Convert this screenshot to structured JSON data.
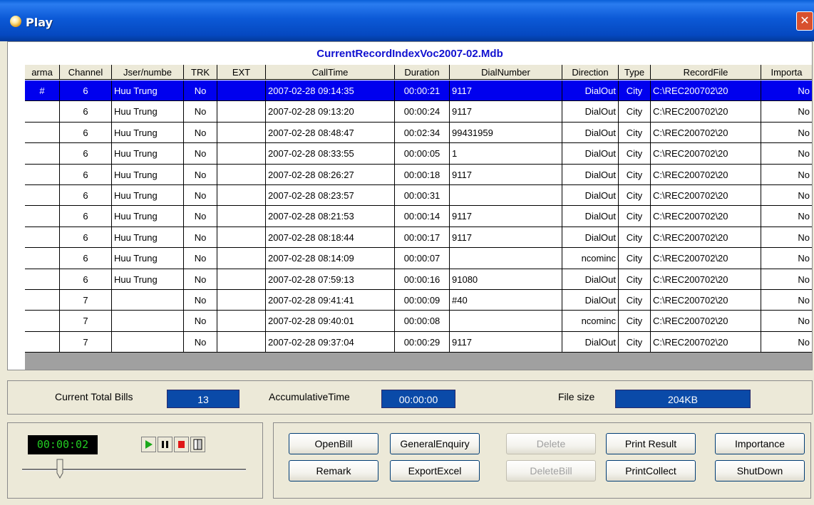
{
  "window": {
    "title": "Play",
    "close_glyph": "✕"
  },
  "grid": {
    "title": "CurrentRecordIndexVoc2007-02.Mdb",
    "columns": [
      "arma",
      "Channel",
      "Jser/numbe",
      "TRK",
      "EXT",
      "CallTime",
      "Duration",
      "DialNumber",
      "Direction",
      "Type",
      "RecordFile",
      "Importa"
    ],
    "rows": [
      [
        "#",
        "6",
        "Huu Trung",
        "No",
        "",
        "2007-02-28 09:14:35",
        "00:00:21",
        "9117",
        "DialOut",
        "City",
        "C:\\REC200702\\20",
        "No"
      ],
      [
        "",
        "6",
        "Huu Trung",
        "No",
        "",
        "2007-02-28 09:13:20",
        "00:00:24",
        "9117",
        "DialOut",
        "City",
        "C:\\REC200702\\20",
        "No"
      ],
      [
        "",
        "6",
        "Huu Trung",
        "No",
        "",
        "2007-02-28 08:48:47",
        "00:02:34",
        "99431959",
        "DialOut",
        "City",
        "C:\\REC200702\\20",
        "No"
      ],
      [
        "",
        "6",
        "Huu Trung",
        "No",
        "",
        "2007-02-28 08:33:55",
        "00:00:05",
        "1",
        "DialOut",
        "City",
        "C:\\REC200702\\20",
        "No"
      ],
      [
        "",
        "6",
        "Huu Trung",
        "No",
        "",
        "2007-02-28 08:26:27",
        "00:00:18",
        "9117",
        "DialOut",
        "City",
        "C:\\REC200702\\20",
        "No"
      ],
      [
        "",
        "6",
        "Huu Trung",
        "No",
        "",
        "2007-02-28 08:23:57",
        "00:00:31",
        "",
        "DialOut",
        "City",
        "C:\\REC200702\\20",
        "No"
      ],
      [
        "",
        "6",
        "Huu Trung",
        "No",
        "",
        "2007-02-28 08:21:53",
        "00:00:14",
        "9117",
        "DialOut",
        "City",
        "C:\\REC200702\\20",
        "No"
      ],
      [
        "",
        "6",
        "Huu Trung",
        "No",
        "",
        "2007-02-28 08:18:44",
        "00:00:17",
        "9117",
        "DialOut",
        "City",
        "C:\\REC200702\\20",
        "No"
      ],
      [
        "",
        "6",
        "Huu Trung",
        "No",
        "",
        "2007-02-28 08:14:09",
        "00:00:07",
        "",
        "ncominc",
        "City",
        "C:\\REC200702\\20",
        "No"
      ],
      [
        "",
        "6",
        "Huu Trung",
        "No",
        "",
        "2007-02-28 07:59:13",
        "00:00:16",
        "91080",
        "DialOut",
        "City",
        "C:\\REC200702\\20",
        "No"
      ],
      [
        "",
        "7",
        "",
        "No",
        "",
        "2007-02-28 09:41:41",
        "00:00:09",
        "#40",
        "DialOut",
        "City",
        "C:\\REC200702\\20",
        "No"
      ],
      [
        "",
        "7",
        "",
        "No",
        "",
        "2007-02-28 09:40:01",
        "00:00:08",
        "",
        "ncominc",
        "City",
        "C:\\REC200702\\20",
        "No"
      ],
      [
        "",
        "7",
        "",
        "No",
        "",
        "2007-02-28 09:37:04",
        "00:00:29",
        "9117",
        "DialOut",
        "City",
        "C:\\REC200702\\20",
        "No"
      ]
    ],
    "selected_row": 0
  },
  "summary": {
    "total_bills_label": "Current Total Bills",
    "total_bills_value": "13",
    "accum_label": "AccumulativeTime",
    "accum_value": "00:00:00",
    "filesize_label": "File size",
    "filesize_value": "204KB"
  },
  "player": {
    "time": "00:00:02",
    "slider_fraction": 0.17,
    "icons": [
      "play-icon",
      "pause-icon",
      "stop-icon",
      "export-icon"
    ]
  },
  "buttons": {
    "row1": [
      {
        "label": "OpenBill",
        "enabled": true
      },
      {
        "label": "GeneralEnquiry",
        "enabled": true
      },
      {
        "label": "Delete",
        "enabled": false
      },
      {
        "label": "Print Result",
        "enabled": true
      },
      {
        "label": "Importance",
        "enabled": true
      }
    ],
    "row2": [
      {
        "label": "Remark",
        "enabled": true
      },
      {
        "label": "ExportExcel",
        "enabled": true
      },
      {
        "label": "DeleteBill",
        "enabled": false
      },
      {
        "label": "PrintCollect",
        "enabled": true
      },
      {
        "label": "ShutDown",
        "enabled": true
      }
    ]
  },
  "colors": {
    "title_bar": "#0548c0",
    "selection": "#0000ee",
    "value_box": "#0a4aa8",
    "lcd_text": "#22cc22"
  }
}
